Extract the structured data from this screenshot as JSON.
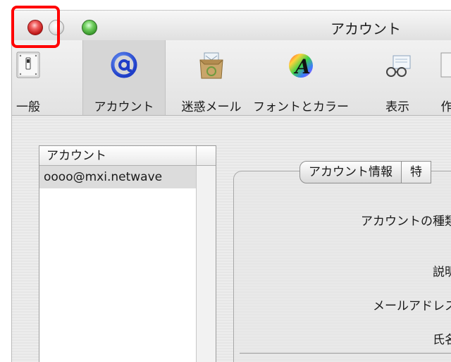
{
  "window": {
    "title": "アカウント"
  },
  "toolbar": {
    "items": [
      {
        "label": "一般",
        "icon": "switch-icon"
      },
      {
        "label": "アカウント",
        "icon": "at-sign-icon"
      },
      {
        "label": "迷惑メール",
        "icon": "junk-mail-icon"
      },
      {
        "label": "フォントとカラー",
        "icon": "font-color-icon"
      },
      {
        "label": "表示",
        "icon": "glasses-icon"
      },
      {
        "label": "作",
        "icon": "compose-icon"
      }
    ],
    "selected_index": 1
  },
  "accounts": {
    "header": "アカウント",
    "rows": [
      "oooo@mxi.netwave"
    ]
  },
  "detail": {
    "tabs": [
      "アカウント情報",
      "特"
    ],
    "fields": [
      "アカウントの種類",
      "説明",
      "メールアドレス",
      "氏名"
    ]
  },
  "colors": {
    "close": "#d42424",
    "minimize": "#dcdcdc",
    "zoom": "#4fb13c",
    "highlight": "#ff0000",
    "at_icon": "#1f3ec8"
  }
}
